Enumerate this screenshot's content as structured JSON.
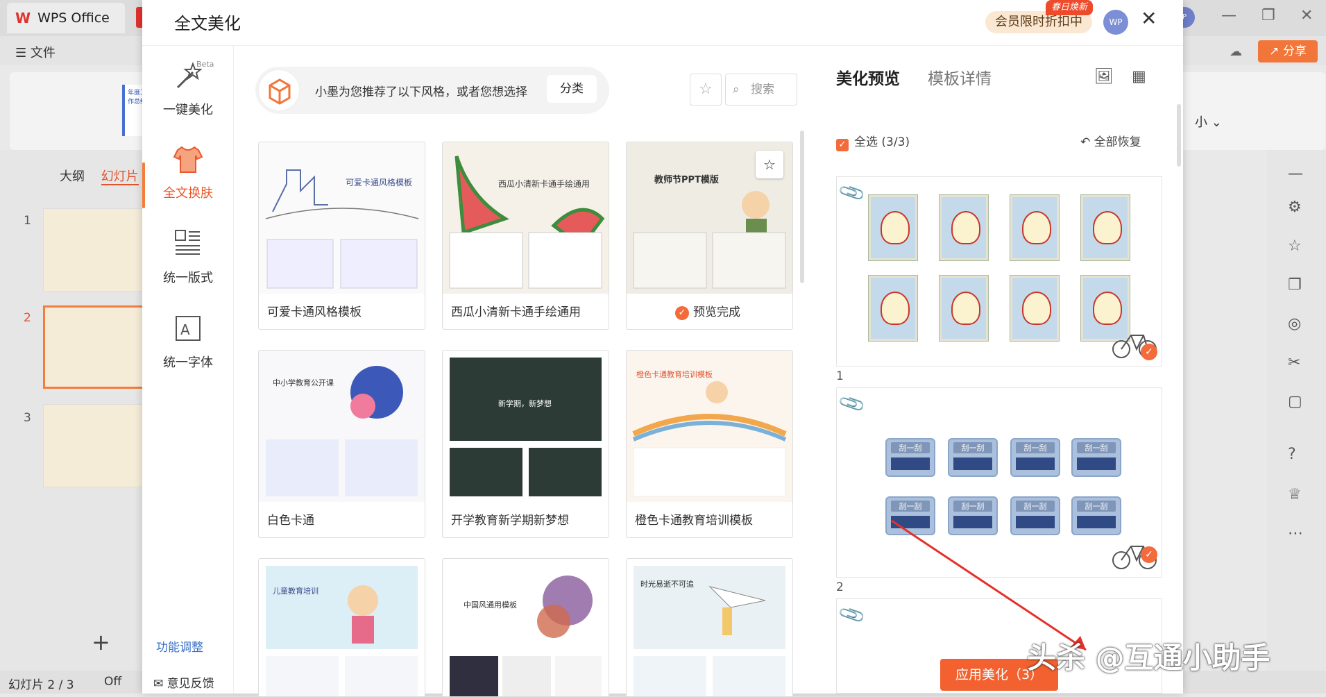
{
  "app": {
    "tab_title": "WPS Office",
    "menu_file": "文件",
    "share": "分享",
    "ribbon_thumb_text": "年度工作总结",
    "ribbon_right_text": "小",
    "status": "幻灯片 2 / 3",
    "status_office": "Off"
  },
  "left_pane": {
    "outline_tab": "大纲",
    "slides_tab": "幻灯片",
    "slide_numbers": [
      "1",
      "2",
      "3"
    ]
  },
  "modal": {
    "title": "全文美化",
    "vip_text": "会员限时折扣中",
    "vip_badge": "春日焕新",
    "avatar": "WP"
  },
  "nav": {
    "items": [
      {
        "label": "一键美化",
        "badge": "Beta"
      },
      {
        "label": "全文换肤"
      },
      {
        "label": "统一版式"
      },
      {
        "label": "统一字体"
      }
    ],
    "func_adjust": "功能调整",
    "feedback": "意见反馈"
  },
  "center": {
    "recommend_text": "小墨为您推荐了以下风格，或者您想选择",
    "category_button": "分类",
    "search_placeholder": "搜索",
    "templates": [
      {
        "name": "可爱卡通风格模板",
        "thumb_title": "可爱卡通风格模板"
      },
      {
        "name": "西瓜小清新卡通手绘通用",
        "thumb_title": "西瓜小清新卡通手绘通用"
      },
      {
        "name": "预览完成",
        "thumb_title": "教师节PPT模版"
      },
      {
        "name": "白色卡通",
        "thumb_title": "中小学教育公开课"
      },
      {
        "name": "开学教育新学期新梦想",
        "thumb_title": "新学期，新梦想"
      },
      {
        "name": "橙色卡通教育培训模板",
        "thumb_title": "橙色卡通教育培训模板"
      },
      {
        "name": "",
        "thumb_title": "儿童教育培训"
      },
      {
        "name": "",
        "thumb_title": "中国风通用模板"
      },
      {
        "name": "",
        "thumb_title": "时光易逝不可追"
      }
    ]
  },
  "right_panel": {
    "tab_preview": "美化预览",
    "tab_detail": "模板详情",
    "select_all": "全选 (3/3)",
    "restore_all": "全部恢复",
    "slide_labels": [
      "1",
      "2"
    ],
    "button_label": "刮一刮",
    "apply_button": "应用美化（3）"
  },
  "watermark": "头杀 @互通小助手",
  "colors": {
    "accent": "#f2612f",
    "link": "#3a72c9"
  }
}
